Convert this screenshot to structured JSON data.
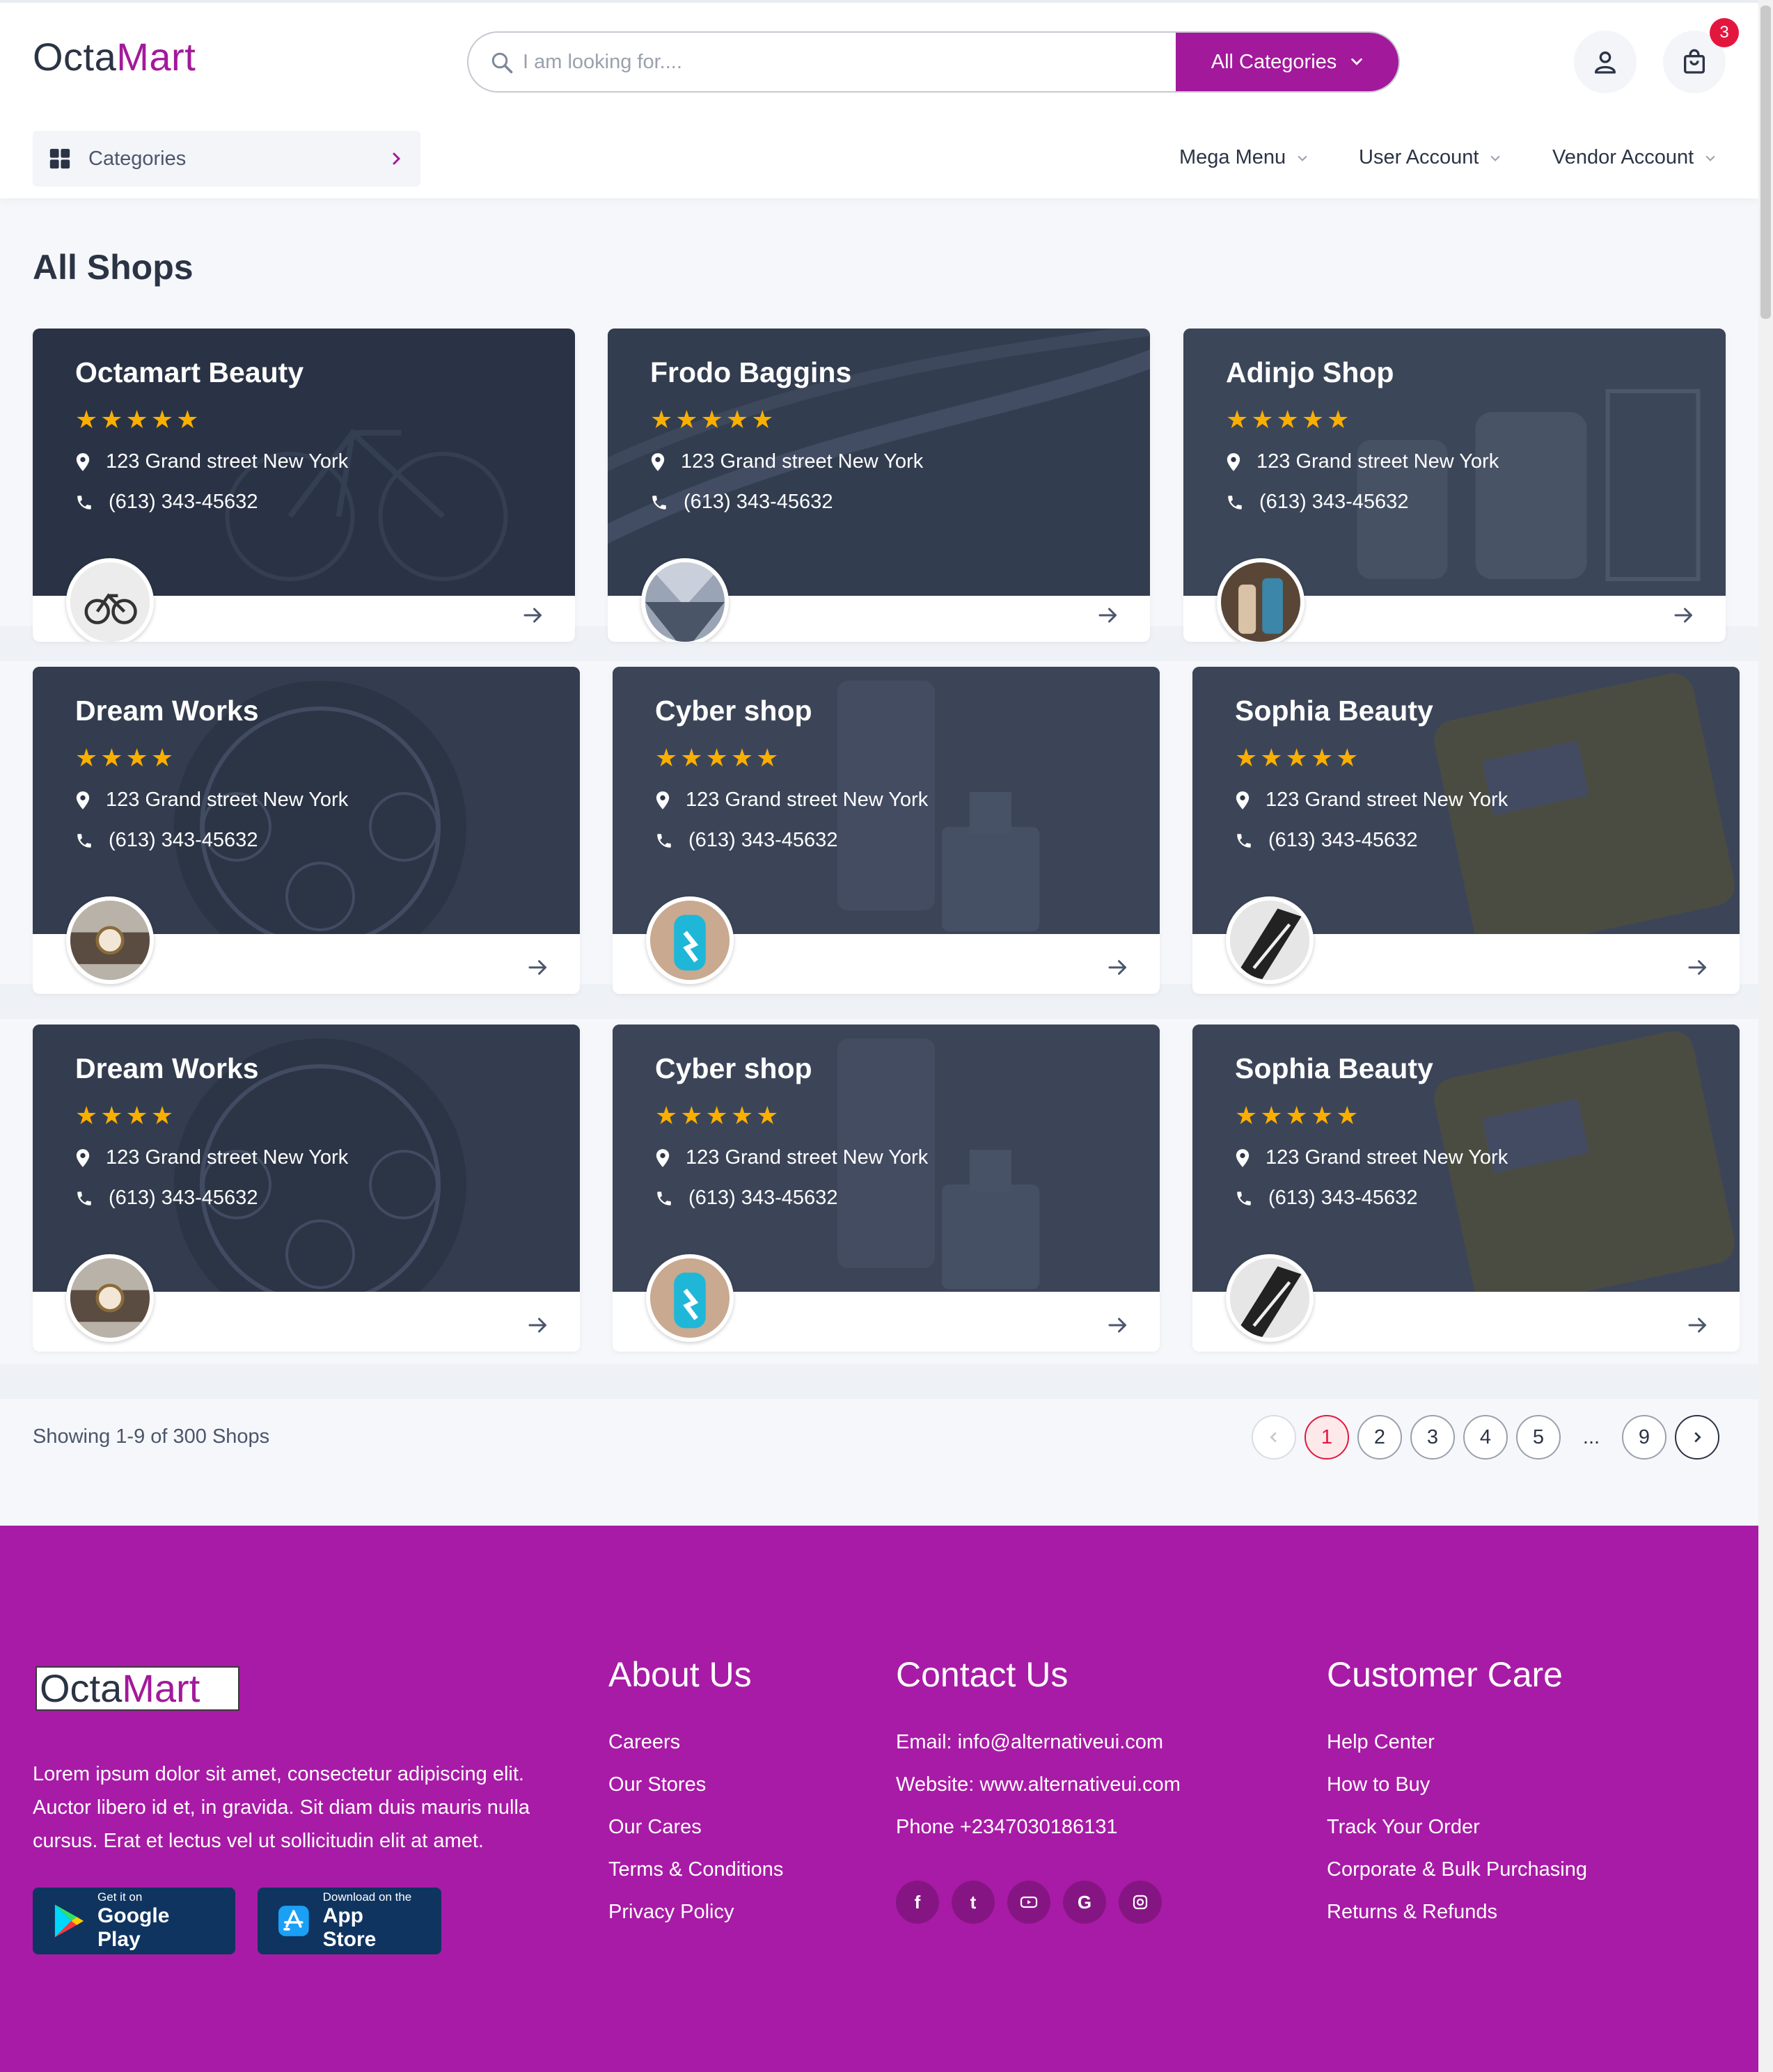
{
  "header": {
    "logo_part1": "Octa",
    "logo_part2": "Mart",
    "search_placeholder": "I am looking for....",
    "category_button": "All Categories",
    "cart_count": "3",
    "categories_label": "Categories",
    "nav": [
      "Mega Menu",
      "User Account",
      "Vendor Account"
    ]
  },
  "page": {
    "title": "All Shops"
  },
  "shops": [
    {
      "name": "Octamart Beauty",
      "stars": "★★★★★",
      "address": "123 Grand street New York",
      "phone": "(613) 343-45632"
    },
    {
      "name": "Frodo Baggins",
      "stars": "★★★★★",
      "address": "123 Grand street New York",
      "phone": "(613) 343-45632"
    },
    {
      "name": "Adinjo Shop",
      "stars": "★★★★★",
      "address": "123 Grand street New York",
      "phone": "(613) 343-45632"
    },
    {
      "name": "Dream Works",
      "stars": "★★★★",
      "address": "123 Grand street New York",
      "phone": "(613) 343-45632"
    },
    {
      "name": "Cyber shop",
      "stars": "★★★★★",
      "address": "123 Grand street New York",
      "phone": "(613) 343-45632"
    },
    {
      "name": "Sophia Beauty",
      "stars": "★★★★★",
      "address": "123 Grand street New York",
      "phone": "(613) 343-45632"
    },
    {
      "name": "Dream Works",
      "stars": "★★★★",
      "address": "123 Grand street New York",
      "phone": "(613) 343-45632"
    },
    {
      "name": "Cyber shop",
      "stars": "★★★★★",
      "address": "123 Grand street New York",
      "phone": "(613) 343-45632"
    },
    {
      "name": "Sophia Beauty",
      "stars": "★★★★★",
      "address": "123 Grand street New York",
      "phone": "(613) 343-45632"
    }
  ],
  "pagination": {
    "showing": "Showing 1-9 of 300 Shops",
    "pages": [
      "1",
      "2",
      "3",
      "4",
      "5",
      "...",
      "9"
    ],
    "current": "1"
  },
  "footer": {
    "logo_part1": "Octa",
    "logo_part2": "Mart",
    "description": "Lorem ipsum dolor sit amet, consectetur adipiscing elit. Auctor libero id et, in gravida. Sit diam duis mauris nulla cursus. Erat et lectus vel ut sollicitudin elit at amet.",
    "google_play_small": "Get it on",
    "google_play_big": "Google Play",
    "app_store_small": "Download on the",
    "app_store_big": "App Store",
    "about": {
      "title": "About Us",
      "links": [
        "Careers",
        "Our Stores",
        "Our Cares",
        "Terms & Conditions",
        "Privacy Policy"
      ]
    },
    "contact": {
      "title": "Contact Us",
      "lines": [
        "Email: info@alternativeui.com",
        "Website: www.alternativeui.com",
        "Phone +2347030186131"
      ],
      "socials": [
        "facebook-icon",
        "twitter-icon",
        "youtube-icon",
        "google-icon",
        "instagram-icon"
      ]
    },
    "care": {
      "title": "Customer Care",
      "links": [
        "Help Center",
        "How to Buy",
        "Track Your Order",
        "Corporate & Bulk Purchasing",
        "Returns & Refunds"
      ]
    }
  },
  "colors": {
    "brand": "#a3199b",
    "footer_bg": "#a81ba6",
    "star": "#faaf00",
    "active_page": "#e3173e",
    "app_button": "#0f3460"
  }
}
